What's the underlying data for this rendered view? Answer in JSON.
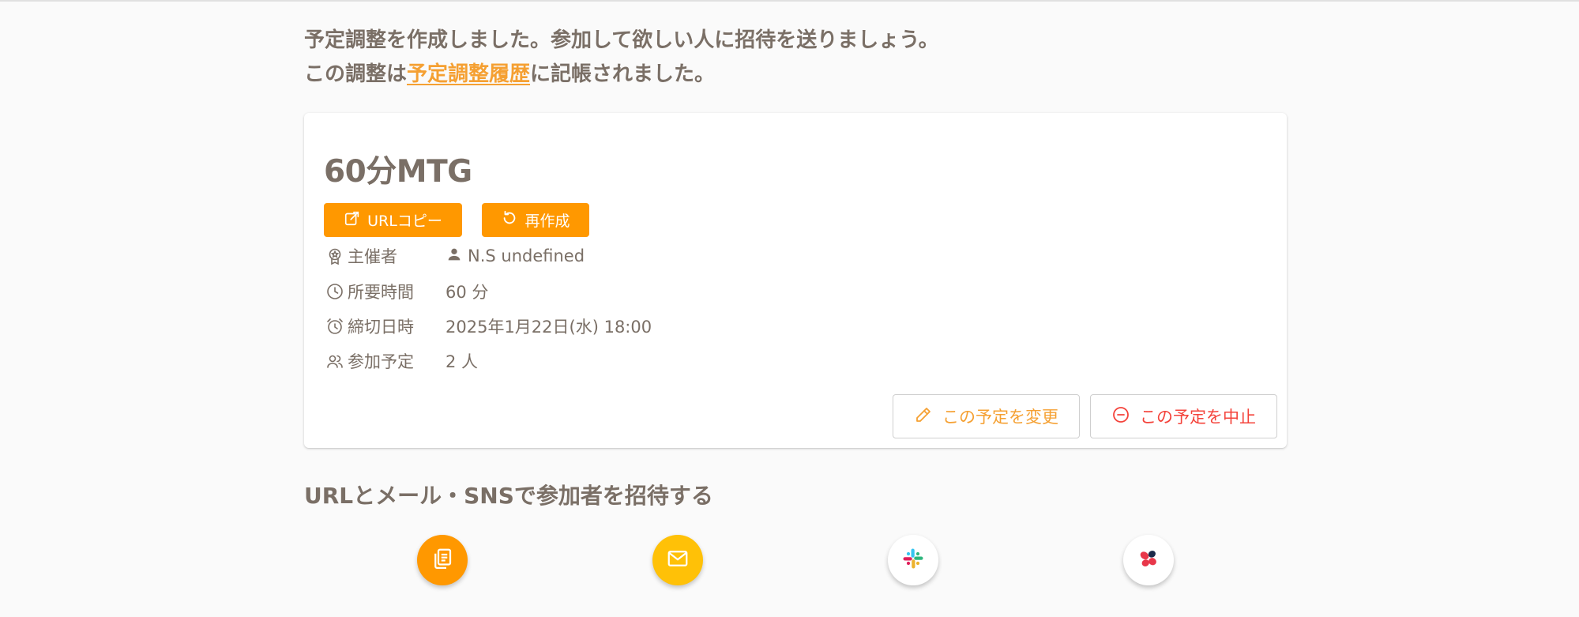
{
  "intro": {
    "line1": "予定調整を作成しました。参加して欲しい人に招待を送りましょう。",
    "line2_prefix": "この調整は",
    "line2_link": "予定調整履歴",
    "line2_suffix": "に記帳されました。"
  },
  "event": {
    "title": "60分MTG",
    "url_copy_label": "URLコピー",
    "recreate_label": "再作成",
    "rows": [
      {
        "icon": "award-icon",
        "label": "主催者",
        "value": "N.S undefined"
      },
      {
        "icon": "clock-icon",
        "label": "所要時間",
        "value": "60 分"
      },
      {
        "icon": "alarm-icon",
        "label": "締切日時",
        "value": "2025年1月22日(水) 18:00"
      },
      {
        "icon": "group-icon",
        "label": "参加予定",
        "value": "2 人"
      }
    ],
    "change_label": "この予定を変更",
    "cancel_label": "この予定を中止"
  },
  "share": {
    "title": "URLとメール・SNSで参加者を招待する",
    "buttons": [
      "copy-icon",
      "mail-icon",
      "slack-icon",
      "app-icon"
    ]
  },
  "colors": {
    "accent": "#ff9800",
    "link": "#f5a032",
    "danger": "#f4433b",
    "text": "#7a6f66",
    "mail": "#ffc107"
  }
}
